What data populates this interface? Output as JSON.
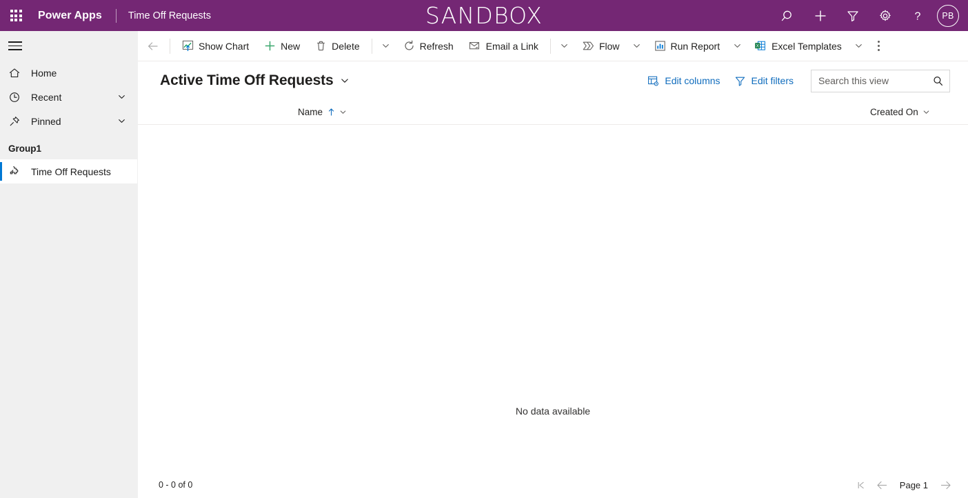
{
  "header": {
    "waffle_icon": "waffle-grid-icon",
    "brand": "Power Apps",
    "app_name": "Time Off Requests",
    "environment_label": "SANDBOX",
    "bar_color": "#742774",
    "icons": [
      {
        "name": "search-icon",
        "label": "Search"
      },
      {
        "name": "plus-icon",
        "label": "Create"
      },
      {
        "name": "filter-icon",
        "label": "Filter"
      },
      {
        "name": "gear-icon",
        "label": "Settings"
      },
      {
        "name": "help-icon",
        "label": "Help"
      }
    ],
    "avatar_initials": "PB"
  },
  "sidebar": {
    "hamburger_label": "Site Map",
    "items": [
      {
        "label": "Home",
        "icon": "home-icon",
        "chevron": false
      },
      {
        "label": "Recent",
        "icon": "clock-icon",
        "chevron": true
      },
      {
        "label": "Pinned",
        "icon": "pin-icon",
        "chevron": true
      }
    ],
    "group_label": "Group1",
    "group_items": [
      {
        "label": "Time Off Requests",
        "icon": "puzzle-icon",
        "selected": true
      }
    ],
    "background": "#f0f0f0",
    "selection_color": "#0078d4"
  },
  "commandbar": {
    "back_label": "Back",
    "commands": [
      {
        "label": "Show Chart",
        "icon": "line-chart-icon",
        "caret": false
      },
      {
        "label": "New",
        "icon": "plus-green-icon",
        "caret": false
      },
      {
        "label": "Delete",
        "icon": "trash-icon",
        "caret": true,
        "separator_before_caret": true
      },
      {
        "label": "Refresh",
        "icon": "refresh-icon",
        "caret": false
      },
      {
        "label": "Email a Link",
        "icon": "email-link-icon",
        "caret": true,
        "separator_before_caret": true
      },
      {
        "label": "Flow",
        "icon": "flow-icon",
        "caret": true
      },
      {
        "label": "Run Report",
        "icon": "report-icon",
        "caret": true
      },
      {
        "label": "Excel Templates",
        "icon": "excel-icon",
        "caret": true
      }
    ],
    "overflow_label": "More commands"
  },
  "view": {
    "title": "Active Time Off Requests",
    "title_chevron": "chevron-down-icon",
    "edit_columns_label": "Edit columns",
    "edit_filters_label": "Edit filters",
    "link_color": "#0f6cbd"
  },
  "search": {
    "placeholder": "Search this view",
    "value": "",
    "icon": "search-icon"
  },
  "grid": {
    "columns": [
      {
        "label": "Name",
        "sorted": "ascending",
        "sort_icon": "arrow-up-icon",
        "chevron": "chevron-down-icon"
      },
      {
        "label": "Created On",
        "sorted": "none",
        "chevron": "chevron-down-icon"
      }
    ],
    "rows": [],
    "empty_message": "No data available"
  },
  "footer": {
    "record_count": "0 - 0 of 0",
    "first_page_label": "First page",
    "previous_page_label": "Previous page",
    "page_label": "Page 1",
    "next_page_label": "Next page"
  }
}
